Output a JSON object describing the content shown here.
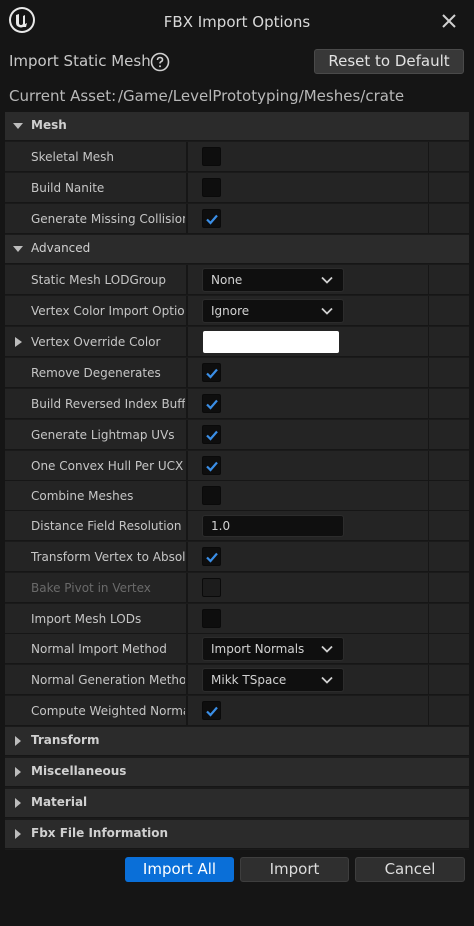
{
  "window": {
    "title": "FBX Import Options"
  },
  "header": {
    "import_title": "Import Static Mesh",
    "reset_label": "Reset to Default",
    "current_asset_label": "Current Asset:",
    "current_asset_value": "/Game/LevelPrototyping/Meshes/crate"
  },
  "sections": {
    "mesh": "Mesh",
    "advanced": "Advanced",
    "transform": "Transform",
    "misc": "Miscellaneous",
    "material": "Material",
    "fbx_info": "Fbx File Information"
  },
  "mesh_props": [
    {
      "label": "Skeletal Mesh",
      "checked": false
    },
    {
      "label": "Build Nanite",
      "checked": false
    },
    {
      "label": "Generate Missing Collision",
      "checked": true
    }
  ],
  "advanced_props": {
    "lod_group": {
      "label": "Static Mesh LODGroup",
      "value": "None"
    },
    "vertex_color": {
      "label": "Vertex Color Import Option",
      "value": "Ignore"
    },
    "vertex_override": {
      "label": "Vertex Override Color",
      "color": "#ffffff"
    },
    "remove_degenerates": {
      "label": "Remove Degenerates",
      "checked": true
    },
    "build_reversed": {
      "label": "Build Reversed Index Buffer",
      "checked": true
    },
    "gen_lightmap": {
      "label": "Generate Lightmap UVs",
      "checked": true
    },
    "one_convex": {
      "label": "One Convex Hull Per UCX",
      "checked": true
    },
    "combine_meshes": {
      "label": "Combine Meshes",
      "checked": false
    },
    "distance_field": {
      "label": "Distance Field Resolution S...",
      "value": "1.0"
    },
    "transform_vertex": {
      "label": "Transform Vertex to Absol...",
      "checked": true
    },
    "bake_pivot": {
      "label": "Bake Pivot in Vertex",
      "checked": false,
      "disabled": true
    },
    "import_lods": {
      "label": "Import Mesh LODs",
      "checked": false
    },
    "normal_import": {
      "label": "Normal Import Method",
      "value": "Import Normals"
    },
    "normal_gen": {
      "label": "Normal Generation Method",
      "value": "Mikk TSpace"
    },
    "weighted_normals": {
      "label": "Compute Weighted Normals",
      "checked": true
    }
  },
  "footer": {
    "import_all": "Import All",
    "import": "Import",
    "cancel": "Cancel"
  },
  "colors": {
    "accent": "#0a6fd8",
    "check": "#3a8ee6",
    "background": "#151515"
  }
}
